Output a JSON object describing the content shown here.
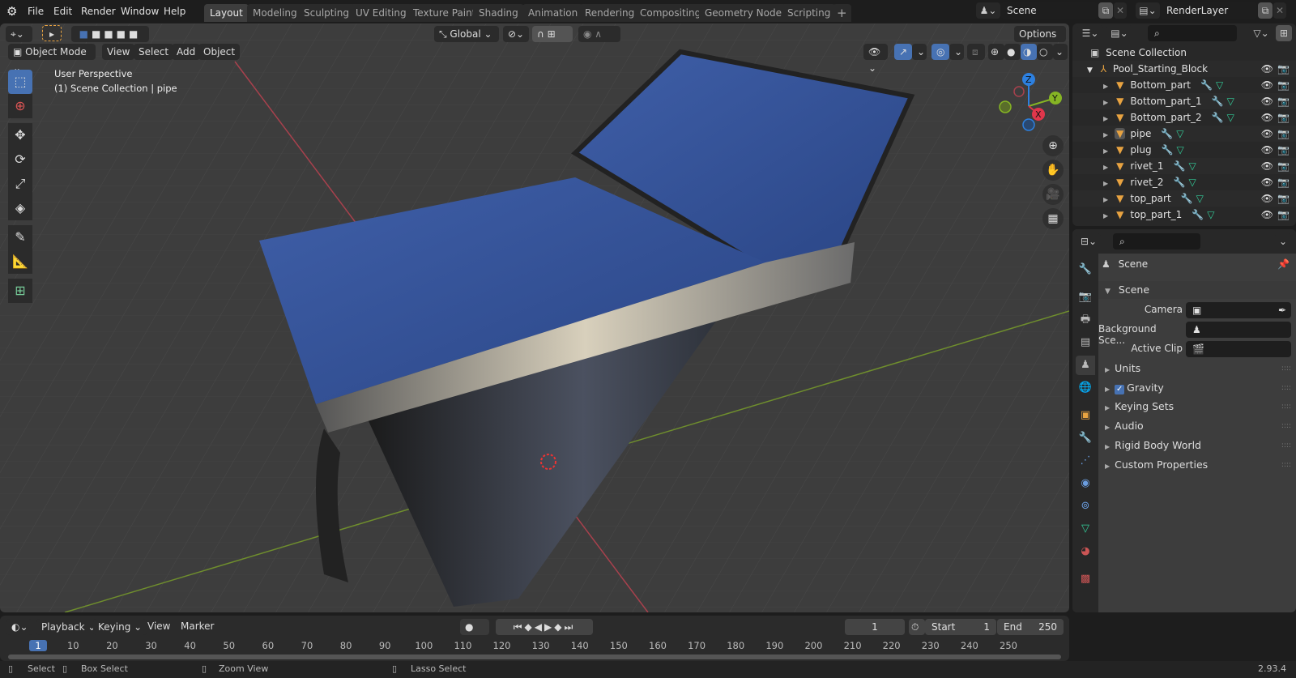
{
  "topbar": {
    "menus": [
      "File",
      "Edit",
      "Render",
      "Window",
      "Help"
    ],
    "workspaces": [
      "Layout",
      "Modeling",
      "Sculpting",
      "UV Editing",
      "Texture Paint",
      "Shading",
      "Animation",
      "Rendering",
      "Compositing",
      "Geometry Nodes",
      "Scripting"
    ],
    "active_workspace": "Layout",
    "add_workspace": "+",
    "scene_name": "Scene",
    "view_layer": "RenderLayer"
  },
  "viewport": {
    "mode": "Object Mode",
    "menus": [
      "View",
      "Select",
      "Add",
      "Object"
    ],
    "orientation": "Global",
    "options": "Options",
    "overlay_title": "User Perspective",
    "overlay_subtitle": "(1) Scene Collection | pipe",
    "gizmo": {
      "z": "Z",
      "y": "Y",
      "x": "X"
    },
    "colors": {
      "x": "#e0364b",
      "y": "#86b524",
      "z": "#2d80e0",
      "accent": "#4772b3"
    }
  },
  "outliner": {
    "root": "Scene Collection",
    "collection": "Pool_Starting_Block",
    "objects": [
      {
        "name": "Bottom_part",
        "selected": false
      },
      {
        "name": "Bottom_part_1",
        "selected": false
      },
      {
        "name": "Bottom_part_2",
        "selected": false
      },
      {
        "name": "pipe",
        "selected": true
      },
      {
        "name": "plug",
        "selected": false
      },
      {
        "name": "rivet_1",
        "selected": false
      },
      {
        "name": "rivet_2",
        "selected": false
      },
      {
        "name": "top_part",
        "selected": false
      },
      {
        "name": "top_part_1",
        "selected": false
      }
    ]
  },
  "properties": {
    "context": "Scene",
    "panel": "Scene",
    "fields": [
      {
        "label": "Camera",
        "value": ""
      },
      {
        "label": "Background Sce...",
        "value": ""
      },
      {
        "label": "Active Clip",
        "value": ""
      }
    ],
    "subpanels": [
      {
        "label": "Units",
        "checkbox": null
      },
      {
        "label": "Gravity",
        "checkbox": true
      },
      {
        "label": "Keying Sets",
        "checkbox": null
      },
      {
        "label": "Audio",
        "checkbox": null
      },
      {
        "label": "Rigid Body World",
        "checkbox": null
      },
      {
        "label": "Custom Properties",
        "checkbox": null
      }
    ]
  },
  "timeline": {
    "menus": [
      "Playback",
      "Keying",
      "View",
      "Marker"
    ],
    "current_frame": "1",
    "start_label": "Start",
    "start": "1",
    "end_label": "End",
    "end": "250",
    "ticks": [
      "1",
      "10",
      "20",
      "30",
      "40",
      "50",
      "60",
      "70",
      "80",
      "90",
      "100",
      "110",
      "120",
      "130",
      "140",
      "150",
      "160",
      "170",
      "180",
      "190",
      "200",
      "210",
      "220",
      "230",
      "240",
      "250"
    ]
  },
  "statusbar": {
    "hints": [
      "Select",
      "Box Select",
      "Zoom View",
      "Lasso Select"
    ],
    "version": "2.93.4"
  }
}
